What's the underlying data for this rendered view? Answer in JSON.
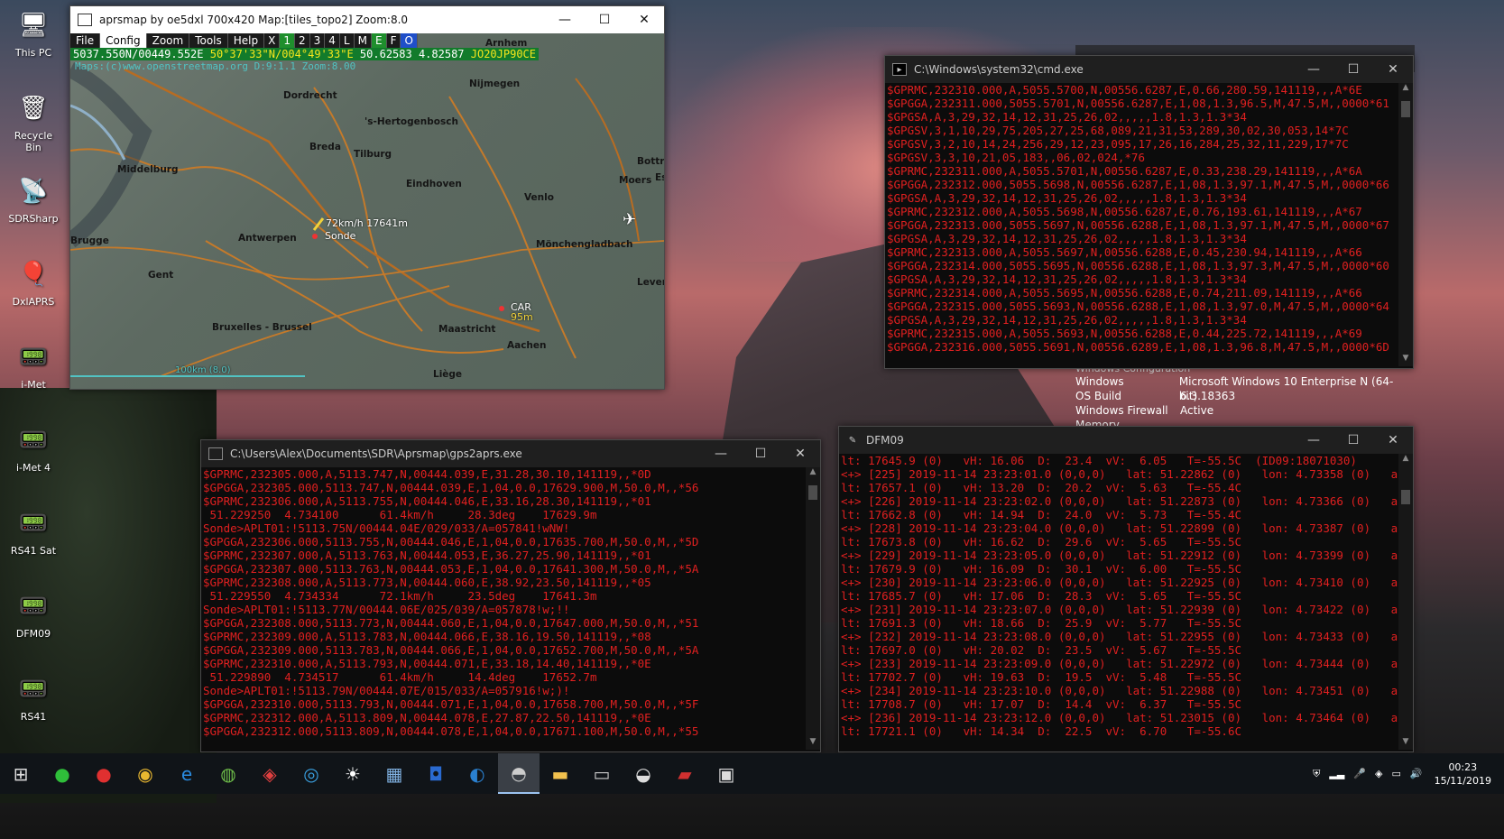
{
  "desktop": {
    "icons": [
      {
        "label": "This PC",
        "icon": "monitor-icon",
        "glyph": "🖥"
      },
      {
        "label": "Recycle Bin",
        "icon": "recycle-bin-icon",
        "glyph": "🗑"
      },
      {
        "label": "SDRSharp",
        "icon": "satellite-dish-icon",
        "glyph": "📡"
      },
      {
        "label": "DxlAPRS",
        "icon": "balloon-icon",
        "glyph": "🎈"
      },
      {
        "label": "i-Met",
        "icon": "radiosonde-icon",
        "glyph": "📟"
      },
      {
        "label": "i-Met 4",
        "icon": "radiosonde-icon",
        "glyph": "📟"
      },
      {
        "label": "RS41 Sat",
        "icon": "radiosonde-icon",
        "glyph": "📟"
      },
      {
        "label": "DFM09",
        "icon": "radiosonde-icon",
        "glyph": "📟"
      },
      {
        "label": "RS41",
        "icon": "radiosonde-icon",
        "glyph": "📟"
      }
    ]
  },
  "aprsmap": {
    "title": "aprsmap by oe5dxl 700x420 Map:[tiles_topo2] Zoom:8.0",
    "menu": [
      "File",
      "Config",
      "Zoom",
      "Tools",
      "Help",
      "X",
      "1",
      "2",
      "3",
      "4",
      "L",
      "M",
      "E",
      "F",
      "O"
    ],
    "selected_menu": "Config",
    "status_a": "5037.550N/00449.552E",
    "status_b": "50°37'33\"N/004°49'33\"E",
    "status_c": "50.62583 4.82587",
    "status_d": "JO20JP90CE",
    "attribution": "Maps:(c)www.openstreetmap.org  D:9:1.1  Zoom:8.00",
    "cities": [
      "Arnhem",
      "Dordrecht",
      "Nijmegen",
      "'s-Hertogenbosch",
      "Breda",
      "Tilburg",
      "Middelburg",
      "Eindhoven",
      "Bottrop",
      "Moers",
      "Es",
      "Venlo",
      "Brugge",
      "Antwerpen",
      "Mönchengladbach",
      "Gent",
      "Lever",
      "Bruxelles - Brussel",
      "Maastricht",
      "Aachen",
      "Liège"
    ],
    "sonde_speed": "72km/h 17641m",
    "sonde_name": "Sonde",
    "car_name": "CAR",
    "car_dist": "95m",
    "scale": "100km (8.0)",
    "accent": "#127b2b"
  },
  "cmd": {
    "title": "C:\\Windows\\system32\\cmd.exe",
    "lines": [
      "$GPRMC,232310.000,A,5055.5700,N,00556.6287,E,0.66,280.59,141119,,,A*6E",
      "$GPGGA,232311.000,5055.5701,N,00556.6287,E,1,08,1.3,96.5,M,47.5,M,,0000*61",
      "$GPGSA,A,3,29,32,14,12,31,25,26,02,,,,,1.8,1.3,1.3*34",
      "$GPGSV,3,1,10,29,75,205,27,25,68,089,21,31,53,289,30,02,30,053,14*7C",
      "$GPGSV,3,2,10,14,24,256,29,12,23,095,17,26,16,284,25,32,11,229,17*7C",
      "$GPGSV,3,3,10,21,05,183,,06,02,024,*76",
      "$GPRMC,232311.000,A,5055.5701,N,00556.6287,E,0.33,238.29,141119,,,A*6A",
      "$GPGGA,232312.000,5055.5698,N,00556.6287,E,1,08,1.3,97.1,M,47.5,M,,0000*66",
      "$GPGSA,A,3,29,32,14,12,31,25,26,02,,,,,1.8,1.3,1.3*34",
      "$GPRMC,232312.000,A,5055.5698,N,00556.6287,E,0.76,193.61,141119,,,A*67",
      "$GPGGA,232313.000,5055.5697,N,00556.6288,E,1,08,1.3,97.1,M,47.5,M,,0000*67",
      "$GPGSA,A,3,29,32,14,12,31,25,26,02,,,,,1.8,1.3,1.3*34",
      "$GPRMC,232313.000,A,5055.5697,N,00556.6288,E,0.45,230.94,141119,,,A*66",
      "$GPGGA,232314.000,5055.5695,N,00556.6288,E,1,08,1.3,97.3,M,47.5,M,,0000*60",
      "$GPGSA,A,3,29,32,14,12,31,25,26,02,,,,,1.8,1.3,1.3*34",
      "$GPRMC,232314.000,A,5055.5695,N,00556.6288,E,0.74,211.09,141119,,,A*66",
      "$GPGGA,232315.000,5055.5693,N,00556.6288,E,1,08,1.3,97.0,M,47.5,M,,0000*64",
      "$GPGSA,A,3,29,32,14,12,31,25,26,02,,,,,1.8,1.3,1.3*34",
      "$GPRMC,232315.000,A,5055.5693,N,00556.6288,E,0.44,225.72,141119,,,A*69",
      "$GPGGA,232316.000,5055.5691,N,00556.6289,E,1,08,1.3,96.8,M,47.5,M,,0000*6D"
    ]
  },
  "gps2aprs": {
    "title": "C:\\Users\\Alex\\Documents\\SDR\\Aprsmap\\gps2aprs.exe",
    "lines": [
      "$GPRMC,232305.000,A,5113.747,N,00444.039,E,31.28,30.10,141119,,*0D",
      "$GPGGA,232305.000,5113.747,N,00444.039,E,1,04,0.0,17629.900,M,50.0,M,,*56",
      "$GPRMC,232306.000,A,5113.755,N,00444.046,E,33.16,28.30,141119,,*01",
      " 51.229250  4.734100      61.4km/h     28.3deg    17629.9m",
      "Sonde>APLT01:!5113.75N/00444.04E/029/033/A=057841!wNW!",
      "$GPGGA,232306.000,5113.755,N,00444.046,E,1,04,0.0,17635.700,M,50.0,M,,*5D",
      "$GPRMC,232307.000,A,5113.763,N,00444.053,E,36.27,25.90,141119,,*01",
      "$GPGGA,232307.000,5113.763,N,00444.053,E,1,04,0.0,17641.300,M,50.0,M,,*5A",
      "$GPRMC,232308.000,A,5113.773,N,00444.060,E,38.92,23.50,141119,,*05",
      " 51.229550  4.734334      72.1km/h     23.5deg    17641.3m",
      "Sonde>APLT01:!5113.77N/00444.06E/025/039/A=057878!w;!!",
      "$GPGGA,232308.000,5113.773,N,00444.060,E,1,04,0.0,17647.000,M,50.0,M,,*51",
      "$GPRMC,232309.000,A,5113.783,N,00444.066,E,38.16,19.50,141119,,*08",
      "$GPGGA,232309.000,5113.783,N,00444.066,E,1,04,0.0,17652.700,M,50.0,M,,*5A",
      "$GPRMC,232310.000,A,5113.793,N,00444.071,E,33.18,14.40,141119,,*0E",
      " 51.229890  4.734517      61.4km/h     14.4deg    17652.7m",
      "Sonde>APLT01:!5113.79N/00444.07E/015/033/A=057916!w;)!",
      "$GPGGA,232310.000,5113.793,N,00444.071,E,1,04,0.0,17658.700,M,50.0,M,,*5F",
      "$GPRMC,232312.000,A,5113.809,N,00444.078,E,27.87,22.50,141119,,*0E",
      "$GPGGA,232312.000,5113.809,N,00444.078,E,1,04,0.0,17671.100,M,50.0,M,,*55"
    ]
  },
  "dfm09": {
    "title": "DFM09",
    "lines": [
      "lt: 17645.9 (0)   vH: 16.06  D:  23.4  vV:  6.05   T=-55.5C  (ID09:18071030)",
      "<+> [225] 2019-11-14 23:23:01.0 (0,0,0)   lat: 51.22862 (0)   lon: 4.73358 (0)   a",
      "lt: 17657.1 (0)   vH: 13.20  D:  20.2  vV:  5.63   T=-55.4C",
      "<+> [226] 2019-11-14 23:23:02.0 (0,0,0)   lat: 51.22873 (0)   lon: 4.73366 (0)   a",
      "lt: 17662.8 (0)   vH: 14.94  D:  24.0  vV:  5.73   T=-55.4C",
      "<+> [228] 2019-11-14 23:23:04.0 (0,0,0)   lat: 51.22899 (0)   lon: 4.73387 (0)   a",
      "lt: 17673.8 (0)   vH: 16.62  D:  29.6  vV:  5.65   T=-55.5C",
      "<+> [229] 2019-11-14 23:23:05.0 (0,0,0)   lat: 51.22912 (0)   lon: 4.73399 (0)   a",
      "lt: 17679.9 (0)   vH: 16.09  D:  30.1  vV:  6.00   T=-55.5C",
      "<+> [230] 2019-11-14 23:23:06.0 (0,0,0)   lat: 51.22925 (0)   lon: 4.73410 (0)   a",
      "lt: 17685.7 (0)   vH: 17.06  D:  28.3  vV:  5.65   T=-55.5C",
      "<+> [231] 2019-11-14 23:23:07.0 (0,0,0)   lat: 51.22939 (0)   lon: 4.73422 (0)   a",
      "lt: 17691.3 (0)   vH: 18.66  D:  25.9  vV:  5.77   T=-55.5C",
      "<+> [232] 2019-11-14 23:23:08.0 (0,0,0)   lat: 51.22955 (0)   lon: 4.73433 (0)   a",
      "lt: 17697.0 (0)   vH: 20.02  D:  23.5  vV:  5.67   T=-55.5C",
      "<+> [233] 2019-11-14 23:23:09.0 (0,0,0)   lat: 51.22972 (0)   lon: 4.73444 (0)   a",
      "lt: 17702.7 (0)   vH: 19.63  D:  19.5  vV:  5.48   T=-55.5C",
      "<+> [234] 2019-11-14 23:23:10.0 (0,0,0)   lat: 51.22988 (0)   lon: 4.73451 (0)   a",
      "lt: 17708.7 (0)   vH: 17.07  D:  14.4  vV:  6.37   T=-55.5C",
      "<+> [236] 2019-11-14 23:23:12.0 (0,0,0)   lat: 51.23015 (0)   lon: 4.73464 (0)   a",
      "lt: 17721.1 (0)   vH: 14.34  D:  22.5  vV:  6.70   T=-55.6C"
    ]
  },
  "sysinfo": {
    "header": "Windows Configuration",
    "rows": [
      {
        "k": "Windows",
        "v": "Microsoft Windows 10 Enterprise N (64-bit)"
      },
      {
        "k": "OS Build",
        "v": "6.3.18363"
      },
      {
        "k": "Windows Firewall",
        "v": "Active"
      },
      {
        "k": "Memory",
        "v": ""
      }
    ]
  },
  "taskbar": {
    "items": [
      {
        "name": "start-button",
        "glyph": "⊞"
      },
      {
        "name": "green-orb-app",
        "glyph": "●",
        "color": "#2fbf3a"
      },
      {
        "name": "red-orb-app",
        "glyph": "●",
        "color": "#e03030"
      },
      {
        "name": "chrome-app",
        "glyph": "◉",
        "color": "#e8b730"
      },
      {
        "name": "edge-app",
        "glyph": "e",
        "color": "#2a8be0"
      },
      {
        "name": "globe-app",
        "glyph": "◍",
        "color": "#6fbf4a"
      },
      {
        "name": "radio-app",
        "glyph": "◈",
        "color": "#e04040"
      },
      {
        "name": "sdr-app",
        "glyph": "◎",
        "color": "#3aa0e0"
      },
      {
        "name": "sun-app",
        "glyph": "☀",
        "color": "#ffffff"
      },
      {
        "name": "satellite-app",
        "glyph": "▦",
        "color": "#7fb0e0"
      },
      {
        "name": "shield-app",
        "glyph": "◘",
        "color": "#2a6ad0"
      },
      {
        "name": "world-app",
        "glyph": "◐",
        "color": "#2a80d0"
      },
      {
        "name": "aprsmap-app",
        "glyph": "◓",
        "color": "#cccccc",
        "active": true
      },
      {
        "name": "explorer-app",
        "glyph": "▬",
        "color": "#f2c14e"
      },
      {
        "name": "terminal-app",
        "glyph": "▭",
        "color": "#cccccc"
      },
      {
        "name": "dish-app",
        "glyph": "◒",
        "color": "#dddddd"
      },
      {
        "name": "car-app",
        "glyph": "▰",
        "color": "#d03030"
      },
      {
        "name": "notes-app",
        "glyph": "▣",
        "color": "#dddddd"
      }
    ],
    "time": "00:23",
    "date": "15/11/2019"
  }
}
